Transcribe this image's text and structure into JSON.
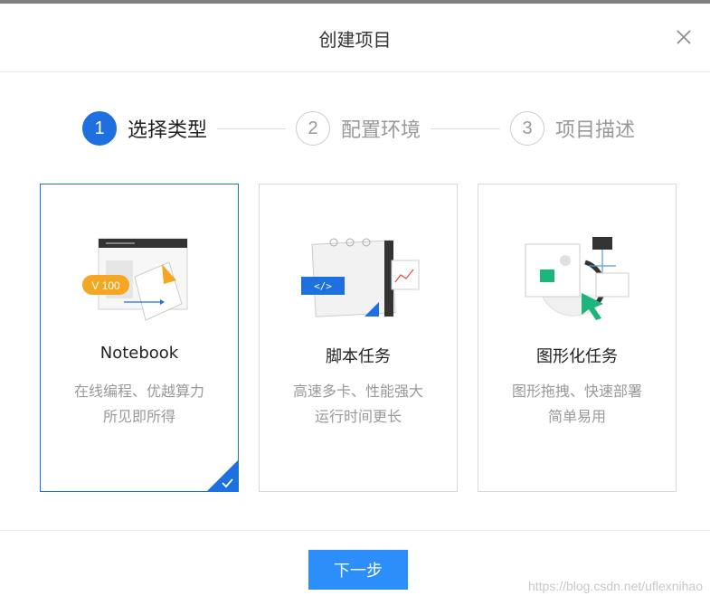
{
  "dialog": {
    "title": "创建项目"
  },
  "steps": [
    {
      "number": "1",
      "label": "选择类型",
      "active": true
    },
    {
      "number": "2",
      "label": "配置环境",
      "active": false
    },
    {
      "number": "3",
      "label": "项目描述",
      "active": false
    }
  ],
  "cards": [
    {
      "title": "Notebook",
      "desc_line1": "在线编程、优越算力",
      "desc_line2": "所见即所得",
      "illus_text": "V 100",
      "selected": true
    },
    {
      "title": "脚本任务",
      "desc_line1": "高速多卡、性能强大",
      "desc_line2": "运行时间更长",
      "illus_text": "</>",
      "selected": false
    },
    {
      "title": "图形化任务",
      "desc_line1": "图形拖拽、快速部署",
      "desc_line2": "简单易用",
      "selected": false
    }
  ],
  "footer": {
    "next_label": "下一步"
  },
  "watermark": "https://blog.csdn.net/uflexnihao",
  "colors": {
    "primary": "#1e6fe0",
    "button": "#2c8ef8",
    "accent_orange": "#f5a623",
    "accent_green": "#1db67a"
  }
}
